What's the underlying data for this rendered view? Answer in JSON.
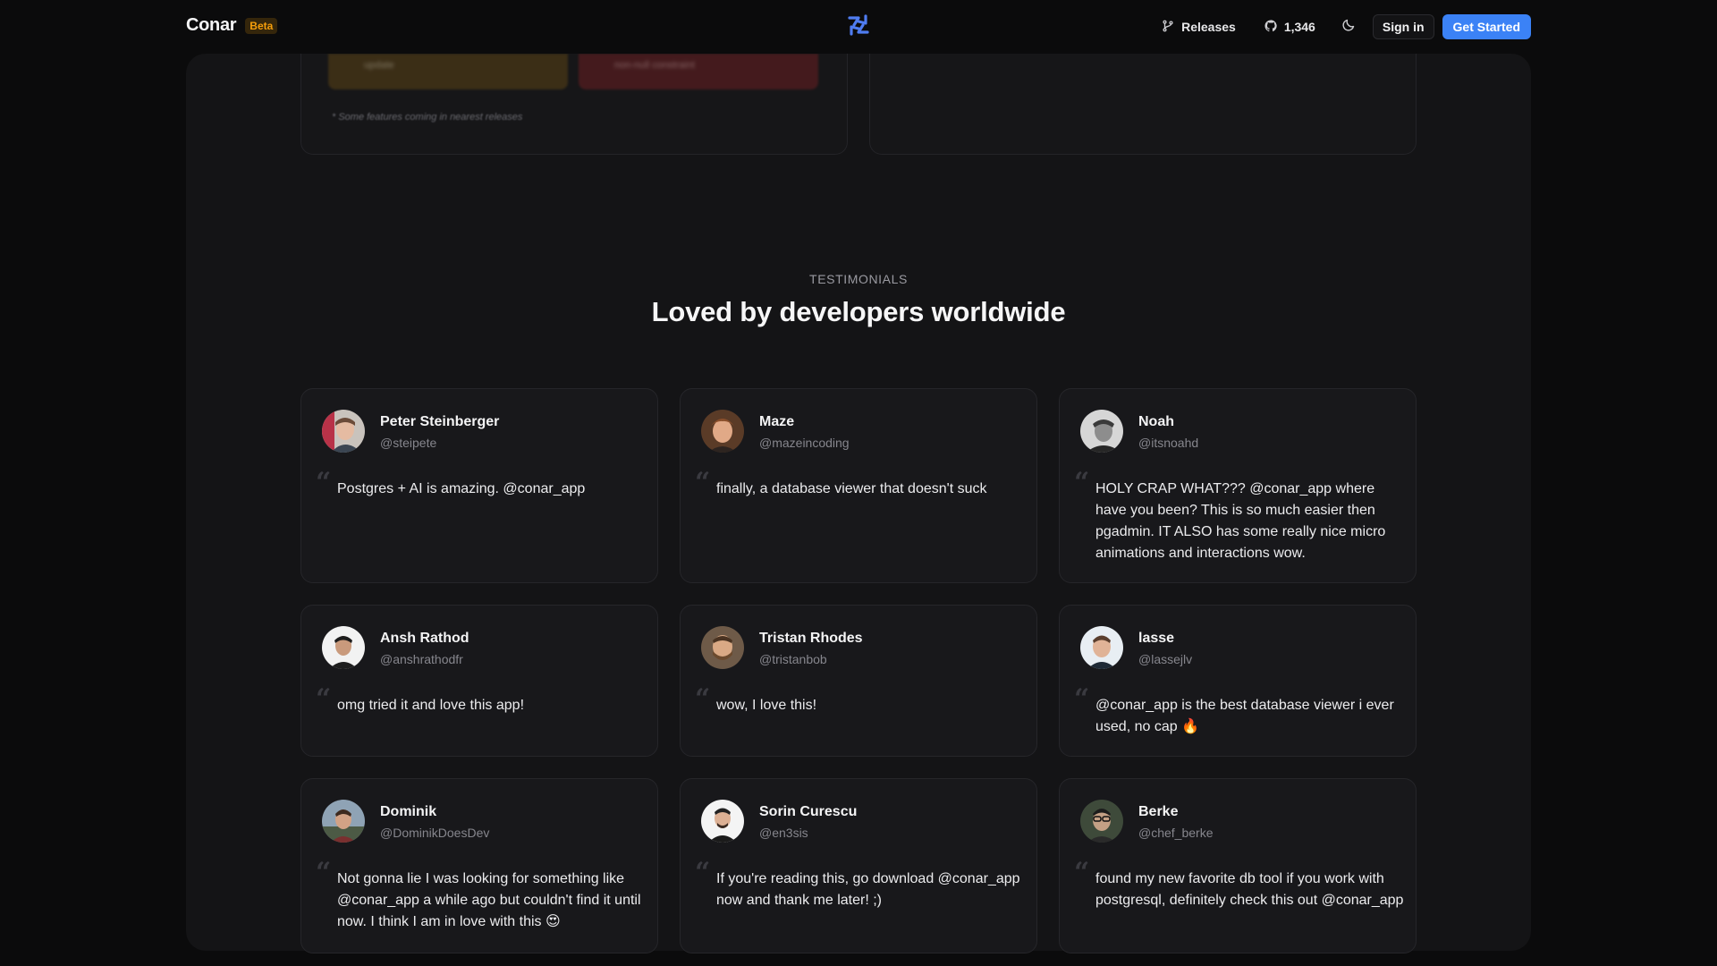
{
  "header": {
    "brand": "Conar",
    "badge": "Beta",
    "nav": {
      "releases_label": "Releases",
      "github_stars": "1,346",
      "sign_in_label": "Sign in",
      "cta_label": "Get Started"
    },
    "icons": {
      "logo": "conar-logo-icon",
      "releases": "git-branch-icon",
      "github": "github-icon",
      "theme": "moon-icon"
    },
    "accent_color": "#3b82f6"
  },
  "features_fragment": {
    "chip_1": "update",
    "chip_2": "non-null constraint",
    "note": "* Some features coming in nearest releases"
  },
  "testimonials": {
    "eyebrow": "TESTIMONIALS",
    "title": "Loved by developers worldwide",
    "items": [
      {
        "name": "Peter Steinberger",
        "handle": "@steipete",
        "text": "Postgres + AI is amazing. @conar_app"
      },
      {
        "name": "Maze",
        "handle": "@mazeincoding",
        "text": "finally, a database viewer that doesn't suck"
      },
      {
        "name": "Noah",
        "handle": "@itsnoahd",
        "text": "HOLY CRAP WHAT??? @conar_app where have you been? This is so much easier then pgadmin. IT ALSO has some really nice micro animations and interactions wow."
      },
      {
        "name": "Ansh Rathod",
        "handle": "@anshrathodfr",
        "text": "omg tried it and love this app!"
      },
      {
        "name": "Tristan Rhodes",
        "handle": "@tristanbob",
        "text": "wow, I love this!"
      },
      {
        "name": "lasse",
        "handle": "@lassejlv",
        "text": "@conar_app is the best database viewer i ever used, no cap 🔥"
      },
      {
        "name": "Dominik",
        "handle": "@DominikDoesDev",
        "text": "Not gonna lie I was looking for something like @conar_app a while ago but couldn't find it until now. I think I am in love with this 😍"
      },
      {
        "name": "Sorin Curescu",
        "handle": "@en3sis",
        "text": "If you're reading this, go download @conar_app now and thank me later! ;)"
      },
      {
        "name": "Berke",
        "handle": "@chef_berke",
        "text": "found my new favorite db tool if you work with postgresql, definitely check this out @conar_app"
      }
    ]
  }
}
